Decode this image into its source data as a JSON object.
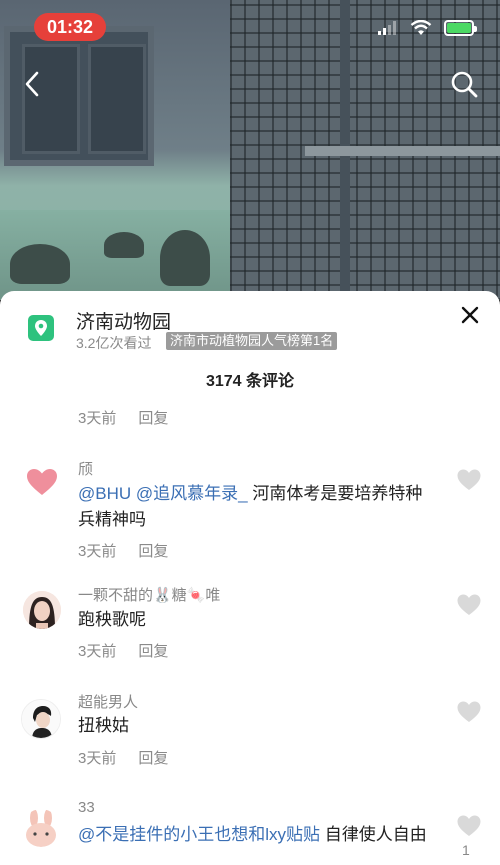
{
  "status_bar": {
    "time": "01:32"
  },
  "poi": {
    "name": "济南动物园",
    "views": "3.2亿次看过",
    "rank_badge": "济南市动植物园人气榜第1名"
  },
  "comment_count": "3174 条评论",
  "prev_comment_meta": {
    "time": "3天前",
    "reply": "回复"
  },
  "comments": [
    {
      "author": "颀",
      "mention1": "@BHU",
      "mention2": "@追风慕年录_",
      "text_after": " 河南体考是要培养特种兵精神吗",
      "time": "3天前",
      "reply": "回复"
    },
    {
      "author": "一颗不甜的🐰糖🍬唯",
      "text": "跑秧歌呢",
      "time": "3天前",
      "reply": "回复"
    },
    {
      "author": "超能男人",
      "text": "扭秧姑",
      "time": "3天前",
      "reply": "回复"
    },
    {
      "author": "33",
      "mention1": "@不是挂件的小王也想和",
      "mention2": "lxy贴贴",
      "text_after": " 自律使人自由",
      "like_count": "1"
    }
  ],
  "colors": {
    "accent_mention": "#3b6fb4",
    "time_pill": "#e6403a",
    "poi_icon": "#2ec27e"
  },
  "icons": [
    "back-arrow-icon",
    "search-icon",
    "location-pin-icon",
    "close-icon",
    "heart-icon",
    "wifi-icon",
    "signal-icon",
    "battery-icon"
  ]
}
